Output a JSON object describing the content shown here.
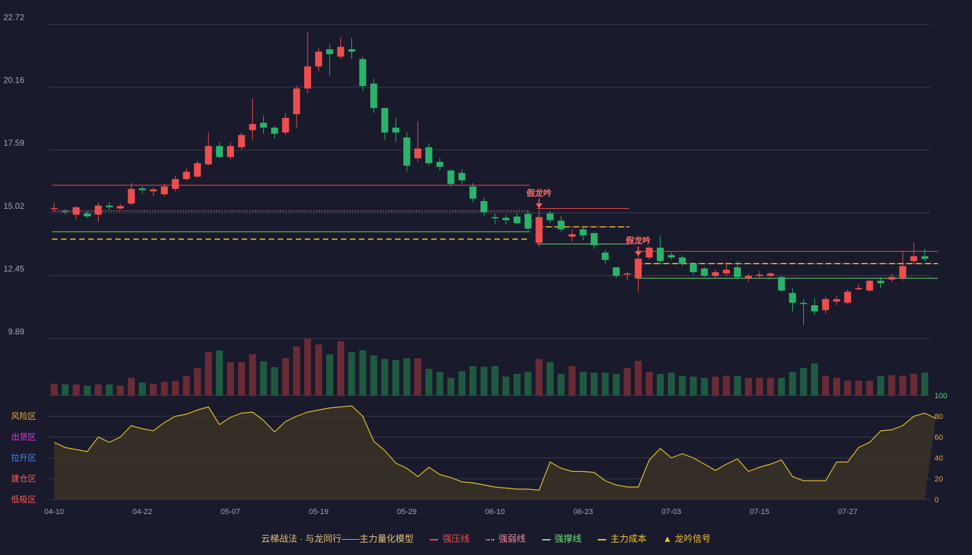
{
  "chart_data": {
    "type": "candlestick",
    "x_ticks": [
      "04-10",
      "04-22",
      "05-07",
      "05-19",
      "05-29",
      "06-10",
      "06-23",
      "07-03",
      "07-15",
      "07-27"
    ],
    "y_ticks": [
      "22.72",
      "20.16",
      "17.59",
      "15.02",
      "12.45",
      "9.89"
    ],
    "ylim": [
      9.89,
      22.72
    ],
    "candles": [
      [
        15.2,
        15.22,
        15.45,
        15.08
      ],
      [
        15.1,
        15.08,
        15.18,
        14.95
      ],
      [
        14.95,
        15.25,
        15.3,
        14.75
      ],
      [
        15.0,
        14.88,
        15.1,
        14.8
      ],
      [
        14.95,
        15.32,
        15.45,
        14.65
      ],
      [
        15.32,
        15.25,
        15.45,
        15.15
      ],
      [
        15.2,
        15.3,
        15.4,
        15.15
      ],
      [
        15.4,
        16.0,
        16.25,
        15.35
      ],
      [
        16.02,
        15.95,
        16.1,
        15.8
      ],
      [
        15.9,
        15.98,
        16.05,
        15.7
      ],
      [
        15.78,
        16.1,
        16.2,
        15.7
      ],
      [
        16.0,
        16.4,
        16.55,
        15.9
      ],
      [
        16.4,
        16.7,
        16.85,
        16.35
      ],
      [
        16.5,
        17.05,
        17.15,
        16.45
      ],
      [
        17.0,
        17.75,
        18.3,
        16.95
      ],
      [
        17.75,
        17.3,
        17.9,
        17.25
      ],
      [
        17.3,
        17.75,
        17.9,
        17.2
      ],
      [
        17.7,
        18.2,
        18.3,
        17.6
      ],
      [
        18.4,
        18.65,
        19.7,
        18.0
      ],
      [
        18.7,
        18.5,
        19.0,
        18.25
      ],
      [
        18.5,
        18.25,
        18.55,
        18.05
      ],
      [
        18.3,
        18.9,
        19.1,
        18.2
      ],
      [
        19.05,
        20.1,
        20.2,
        18.5
      ],
      [
        20.1,
        21.0,
        22.4,
        19.9
      ],
      [
        21.0,
        21.6,
        21.75,
        20.8
      ],
      [
        21.7,
        21.5,
        21.9,
        20.6
      ],
      [
        21.4,
        21.8,
        22.2,
        21.3
      ],
      [
        21.7,
        21.6,
        22.15,
        21.3
      ],
      [
        21.3,
        20.2,
        21.4,
        20.0
      ],
      [
        20.3,
        19.3,
        20.5,
        19.1
      ],
      [
        19.3,
        18.3,
        19.3,
        18.0
      ],
      [
        18.5,
        18.3,
        18.9,
        17.9
      ],
      [
        18.1,
        16.95,
        18.3,
        16.7
      ],
      [
        17.25,
        17.65,
        18.75,
        17.1
      ],
      [
        17.7,
        17.05,
        17.85,
        16.95
      ],
      [
        17.1,
        16.9,
        17.25,
        16.75
      ],
      [
        16.75,
        16.2,
        16.8,
        16.1
      ],
      [
        16.65,
        16.35,
        16.8,
        16.2
      ],
      [
        16.1,
        15.6,
        16.25,
        15.45
      ],
      [
        15.5,
        15.05,
        15.65,
        14.9
      ],
      [
        14.85,
        14.8,
        15.0,
        14.55
      ],
      [
        14.82,
        14.72,
        14.95,
        14.55
      ],
      [
        14.87,
        14.6,
        15.02,
        14.55
      ],
      [
        14.98,
        14.38,
        15.1,
        14.3
      ],
      [
        13.8,
        14.85,
        15.15,
        13.65
      ],
      [
        15.0,
        14.72,
        15.1,
        14.6
      ],
      [
        14.7,
        14.35,
        14.9,
        14.25
      ],
      [
        14.05,
        14.15,
        14.35,
        13.85
      ],
      [
        14.35,
        14.1,
        14.45,
        13.9
      ],
      [
        14.2,
        13.7,
        14.2,
        13.55
      ],
      [
        13.4,
        13.1,
        13.5,
        12.95
      ],
      [
        12.8,
        12.45,
        12.8,
        12.35
      ],
      [
        12.5,
        12.55,
        12.6,
        12.25
      ],
      [
        12.35,
        13.15,
        13.25,
        11.8
      ],
      [
        13.2,
        13.6,
        13.65,
        13.1
      ],
      [
        13.6,
        13.05,
        14.1,
        12.95
      ],
      [
        13.3,
        13.2,
        13.4,
        13.1
      ],
      [
        13.2,
        12.95,
        13.3,
        12.85
      ],
      [
        12.95,
        12.6,
        13.0,
        12.5
      ],
      [
        12.75,
        12.45,
        12.8,
        12.4
      ],
      [
        12.45,
        12.6,
        12.7,
        12.35
      ],
      [
        12.55,
        12.7,
        13.0,
        12.45
      ],
      [
        12.8,
        12.4,
        13.05,
        12.3
      ],
      [
        12.35,
        12.45,
        12.55,
        12.2
      ],
      [
        12.45,
        12.5,
        12.65,
        12.35
      ],
      [
        12.45,
        12.55,
        12.6,
        12.4
      ],
      [
        12.4,
        11.85,
        12.45,
        11.8
      ],
      [
        11.75,
        11.35,
        11.95,
        11.0
      ],
      [
        11.35,
        11.3,
        11.5,
        10.45
      ],
      [
        11.25,
        11.0,
        11.55,
        10.85
      ],
      [
        11.05,
        11.5,
        11.6,
        10.9
      ],
      [
        11.4,
        11.5,
        11.65,
        11.25
      ],
      [
        11.35,
        11.8,
        11.9,
        11.3
      ],
      [
        11.9,
        11.95,
        12.1,
        11.85
      ],
      [
        11.85,
        12.25,
        12.3,
        11.8
      ],
      [
        12.25,
        12.15,
        12.4,
        11.95
      ],
      [
        12.3,
        12.4,
        12.55,
        12.2
      ],
      [
        12.35,
        12.85,
        13.45,
        12.25
      ],
      [
        13.05,
        13.25,
        13.8,
        12.95
      ],
      [
        13.25,
        13.15,
        13.55,
        13.05
      ]
    ],
    "volume": [
      0.3,
      0.28,
      0.28,
      0.25,
      0.28,
      0.28,
      0.25,
      0.45,
      0.33,
      0.3,
      0.35,
      0.37,
      0.5,
      0.7,
      1.1,
      1.15,
      0.85,
      0.85,
      1.05,
      0.87,
      0.72,
      0.95,
      1.25,
      1.45,
      1.3,
      1.05,
      1.38,
      1.1,
      1.15,
      1.02,
      0.93,
      0.9,
      0.95,
      0.95,
      0.68,
      0.6,
      0.45,
      0.62,
      0.75,
      0.73,
      0.75,
      0.48,
      0.55,
      0.6,
      0.93,
      0.85,
      0.55,
      0.75,
      0.6,
      0.58,
      0.58,
      0.55,
      0.7,
      0.88,
      0.6,
      0.55,
      0.58,
      0.5,
      0.48,
      0.45,
      0.48,
      0.5,
      0.5,
      0.45,
      0.45,
      0.45,
      0.45,
      0.6,
      0.7,
      0.82,
      0.5,
      0.45,
      0.38,
      0.38,
      0.38,
      0.5,
      0.52,
      0.5,
      0.55,
      0.58
    ],
    "indicator": [
      55,
      50,
      48,
      46,
      60,
      55,
      60,
      71,
      68,
      66,
      74,
      80,
      82,
      86,
      89,
      72,
      79,
      83,
      84,
      76,
      65,
      75,
      80,
      84,
      86,
      88,
      89,
      90,
      80,
      56,
      47,
      35,
      30,
      22,
      31,
      24,
      21,
      17,
      16,
      14,
      12,
      11,
      10,
      10,
      9,
      36,
      30,
      27,
      27,
      26,
      18,
      14,
      12,
      12,
      38,
      49,
      40,
      44,
      40,
      34,
      28,
      34,
      39,
      27,
      31,
      34,
      38,
      22,
      18,
      18,
      18,
      36,
      36,
      50,
      55,
      66,
      67,
      71,
      80,
      83,
      78
    ],
    "indicator_range": [
      0,
      100
    ],
    "indicator_ticks": [
      "100",
      "80",
      "60",
      "40",
      "20",
      "0"
    ],
    "zones": [
      {
        "label": "风险区",
        "color": "#e8b24a"
      },
      {
        "label": "出货区",
        "color": "#e040e0"
      },
      {
        "label": "拉升区",
        "color": "#3f8cff"
      },
      {
        "label": "建仓区",
        "color": "#ff5b5b"
      },
      {
        "label": "低吸区",
        "color": "#ff5b5b"
      }
    ],
    "lines": [
      {
        "i0": 0,
        "i1": 43,
        "resist": 16.15,
        "weak": 15.1,
        "support": 14.25,
        "cost": 13.95
      },
      {
        "i0": 44,
        "i1": 52,
        "resist": 15.2,
        "weak": 14.45,
        "support": 13.75,
        "cost": 14.45
      },
      {
        "i0": 53,
        "i1": 80,
        "resist": 13.45,
        "weak": 12.95,
        "support": 12.35,
        "cost": 12.95
      }
    ],
    "signals": [
      {
        "i": 44,
        "price": 15.15,
        "label": "假龙吟"
      },
      {
        "i": 53,
        "price": 13.2,
        "label": "假龙吟"
      }
    ],
    "colors": {
      "up": "#ee4e4e",
      "down": "#2ab36a",
      "vol_up": "#6a2b35",
      "vol_down": "#1f5a40",
      "resist": "#ee4e4e",
      "weak": "#f08aa0",
      "support": "#6ee27a",
      "cost": "#f2c230",
      "indicator": "#e7c62e",
      "grid": "#3a3c52",
      "axis_text": "#a5a8b8"
    }
  },
  "legend": {
    "title": "云梯战法 · 与龙同行——主力量化模型",
    "items": [
      "强压线",
      "强弱线",
      "强撑线",
      "主力成本",
      "龙吟信号"
    ],
    "signal_icon": "▲"
  }
}
